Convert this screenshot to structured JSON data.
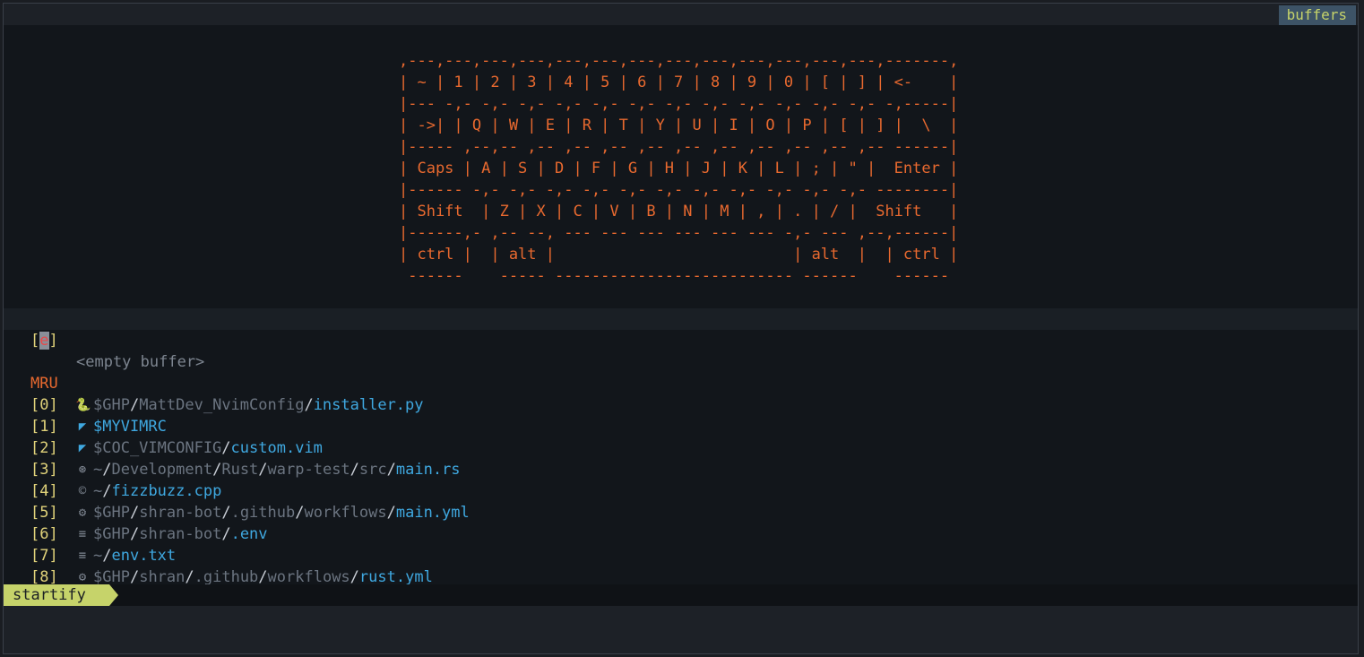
{
  "tabline": {
    "buffers_label": "buffers"
  },
  "keyboard_art": [
    ",---,---,---,---,---,---,---,---,---,---,---,---,---,-------,",
    "| ~ | 1 | 2 | 3 | 4 | 5 | 6 | 7 | 8 | 9 | 0 | [ | ] | <-    |",
    "|--- -,- -,- -,- -,- -,- -,- -,- -,- -,- -,- -,- -,- -,-----|",
    "| ->| | Q | W | E | R | T | Y | U | I | O | P | [ | ] |  \\  |",
    "|----- ,--,-- ,-- ,-- ,-- ,-- ,-- ,-- ,-- ,-- ,-- ,-- ------|",
    "| Caps | A | S | D | F | G | H | J | K | L | ; | \" |  Enter |",
    "|------ -,- -,- -,- -,- -,- -,- -,- -,- -,- -,- -,- --------|",
    "| Shift  | Z | X | C | V | B | N | M | , | . | / |  Shift   |",
    "|------,- ,-- --, --- --- --- --- --- --- -,- --- ,--,------|",
    "| ctrl |  | alt |                          | alt  |  | ctrl |",
    " ------    ----- -------------------------- ------    ------"
  ],
  "empty_buffer": {
    "key_open": "[",
    "key": "e",
    "key_close": "]",
    "label": "<empty buffer>"
  },
  "mru_header": "MRU",
  "mru": [
    {
      "idx": "[0]",
      "icon": "python-icon",
      "glyph": "🐍",
      "parts": [
        [
          "$GHP",
          "d"
        ],
        [
          "/",
          "w"
        ],
        [
          "MattDev_NvimConfig",
          "d"
        ],
        [
          "/",
          "w"
        ],
        [
          "installer.py",
          "h"
        ]
      ]
    },
    {
      "idx": "[1]",
      "icon": "vim-icon",
      "glyph": "◤",
      "parts": [
        [
          "$MYVIMRC",
          "h"
        ]
      ]
    },
    {
      "idx": "[2]",
      "icon": "vim-icon",
      "glyph": "◤",
      "parts": [
        [
          "$COC_VIMCONFIG",
          "d"
        ],
        [
          "/",
          "w"
        ],
        [
          "custom.vim",
          "h"
        ]
      ]
    },
    {
      "idx": "[3]",
      "icon": "rust-icon",
      "glyph": "⊛",
      "parts": [
        [
          "~",
          "d"
        ],
        [
          "/",
          "w"
        ],
        [
          "Development",
          "d"
        ],
        [
          "/",
          "w"
        ],
        [
          "Rust",
          "d"
        ],
        [
          "/",
          "w"
        ],
        [
          "warp-test",
          "d"
        ],
        [
          "/",
          "w"
        ],
        [
          "src",
          "d"
        ],
        [
          "/",
          "w"
        ],
        [
          "main.rs",
          "h"
        ]
      ]
    },
    {
      "idx": "[4]",
      "icon": "cpp-icon",
      "glyph": "©",
      "parts": [
        [
          "~",
          "d"
        ],
        [
          "/",
          "w"
        ],
        [
          "fizzbuzz.cpp",
          "h"
        ]
      ]
    },
    {
      "idx": "[5]",
      "icon": "gear-icon",
      "glyph": "⚙",
      "parts": [
        [
          "$GHP",
          "d"
        ],
        [
          "/",
          "w"
        ],
        [
          "shran-bot",
          "d"
        ],
        [
          "/",
          "w"
        ],
        [
          ".github",
          "d"
        ],
        [
          "/",
          "w"
        ],
        [
          "workflows",
          "d"
        ],
        [
          "/",
          "w"
        ],
        [
          "main.yml",
          "h"
        ]
      ]
    },
    {
      "idx": "[6]",
      "icon": "text-file-icon",
      "glyph": "≡",
      "parts": [
        [
          "$GHP",
          "d"
        ],
        [
          "/",
          "w"
        ],
        [
          "shran-bot",
          "d"
        ],
        [
          "/",
          "w"
        ],
        [
          ".env",
          "h"
        ]
      ]
    },
    {
      "idx": "[7]",
      "icon": "text-file-icon",
      "glyph": "≡",
      "parts": [
        [
          "~",
          "d"
        ],
        [
          "/",
          "w"
        ],
        [
          "env.txt",
          "h"
        ]
      ]
    },
    {
      "idx": "[8]",
      "icon": "gear-icon",
      "glyph": "⚙",
      "parts": [
        [
          "$GHP",
          "d"
        ],
        [
          "/",
          "w"
        ],
        [
          "shran",
          "d"
        ],
        [
          "/",
          "w"
        ],
        [
          ".github",
          "d"
        ],
        [
          "/",
          "w"
        ],
        [
          "workflows",
          "d"
        ],
        [
          "/",
          "w"
        ],
        [
          "rust.yml",
          "h"
        ]
      ]
    }
  ],
  "statusline": {
    "mode": "startify"
  },
  "colors": {
    "accent": "#e8692f",
    "index": "#e0d27a",
    "file": "#3fa8e0",
    "mode_bg": "#c6d36a",
    "tab_bg": "#3d5366"
  }
}
